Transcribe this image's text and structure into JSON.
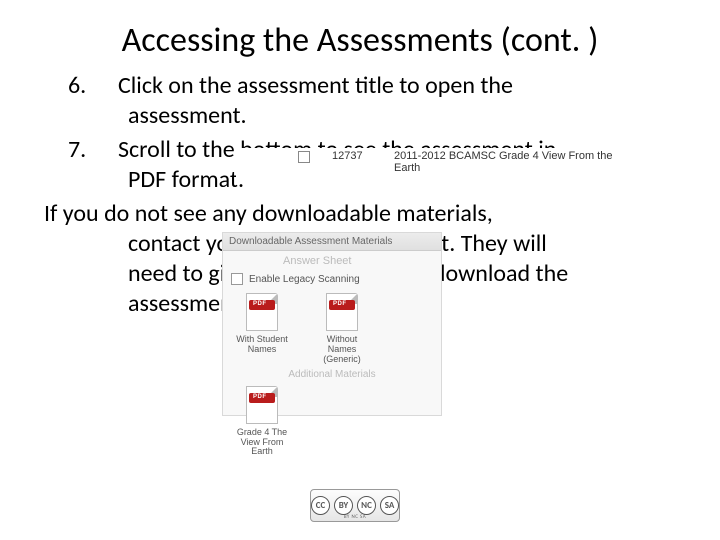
{
  "title": "Accessing the Assessments (cont. )",
  "steps": {
    "num6": "6.",
    "text6a": "Click on the assessment title to open the",
    "text6b": "assessment.",
    "num7": "7.",
    "text7a": "Scroll to the bottom to see the assessment in",
    "text7b": "PDF format."
  },
  "para": {
    "l1": "If you do not see any downloadable materials,",
    "l2": "contact your district data contact. They will",
    "l3": "need to give you permission to download the",
    "l4": "assessment materials."
  },
  "inset1": {
    "id": "12737",
    "name": "2011-2012 BCAMSC Grade 4 View From the Earth"
  },
  "inset2": {
    "header": "Downloadable Assessment Materials",
    "answer_sheet": "Answer Sheet",
    "legacy": "Enable Legacy Scanning",
    "thumb1": "With Student Names",
    "thumb2": "Without Names (Generic)",
    "additional": "Additional Materials",
    "thumb3": "Grade 4 The View From Earth"
  },
  "cc": {
    "a": "CC",
    "b": "BY",
    "c": "NC",
    "d": "SA",
    "sub": "BY   NC   SA"
  }
}
